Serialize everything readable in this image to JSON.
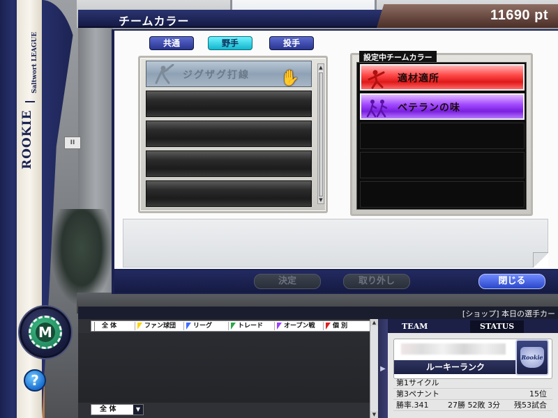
{
  "header": {
    "title": "チームカラー",
    "points": "11690 pt"
  },
  "sidebar": {
    "brand": "ROOKIE",
    "league": "Saltwort LEAGUE",
    "menu_letter": "M",
    "help_symbol": "?"
  },
  "background": {
    "socket_label": "II"
  },
  "tabs": [
    {
      "label": "共通",
      "active": false
    },
    {
      "label": "野手",
      "active": true
    },
    {
      "label": "投手",
      "active": false
    }
  ],
  "color_list": {
    "items": [
      {
        "label": "ジグザグ打線",
        "selected": true,
        "icon": "batter-icon"
      }
    ],
    "empty_slots": 4
  },
  "current_colors": {
    "title": "設定中チームカラー",
    "items": [
      {
        "label": "適材適所",
        "color": "#ff3b3b",
        "icon": "pitcher-icon"
      },
      {
        "label": "ベテランの味",
        "color": "#9b3fff",
        "icon": "runners-icon"
      }
    ],
    "empty_slots": 3
  },
  "actions": {
    "decide": "決定",
    "remove": "取り外し",
    "close": "閉じる"
  },
  "ticker": {
    "text": "[ショップ] 本日の選手カー"
  },
  "chat": {
    "filters": [
      {
        "label": "全 体",
        "color": "#ffffff"
      },
      {
        "label": "ファン球団",
        "color": "#ffd400"
      },
      {
        "label": "リーグ",
        "color": "#3f6dff"
      },
      {
        "label": "トレード",
        "color": "#2ea84a"
      },
      {
        "label": "オープン戦",
        "color": "#9b3fff"
      },
      {
        "label": "個 別",
        "color": "#e02020"
      }
    ],
    "select_value": "全 体"
  },
  "team_panel": {
    "tabs": {
      "team": "TEAM",
      "status": "STATUS"
    },
    "rank": "ルーキーランク",
    "badge_text": "Rookie",
    "cycle": "第1サイクル",
    "pennant": "第3ペナント",
    "pennant_position": "15位",
    "win_rate": "勝率.341",
    "record": "27勝 52敗 3分",
    "remaining": "残53試合"
  }
}
